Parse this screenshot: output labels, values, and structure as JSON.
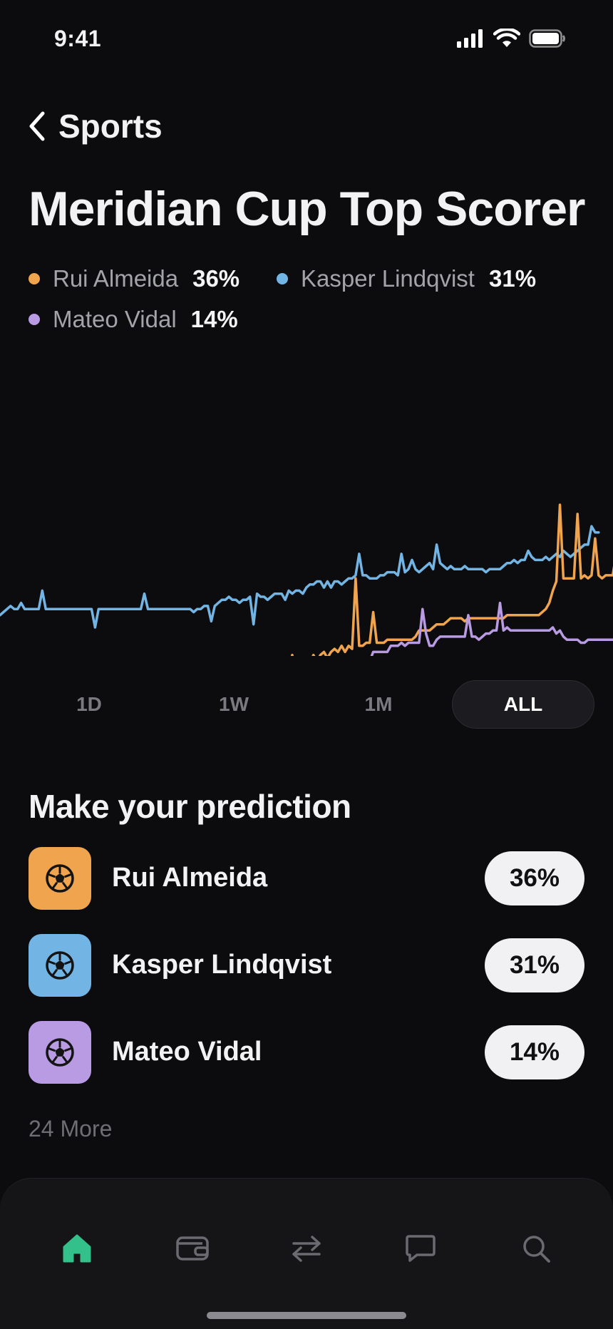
{
  "status_bar": {
    "time": "9:41"
  },
  "nav": {
    "back_label": "Sports"
  },
  "market": {
    "title": "Meridian Cup Top Scorer"
  },
  "legend": [
    {
      "name": "Rui Almeida",
      "pct": "36%",
      "color": "#f0a44e"
    },
    {
      "name": "Kasper Lindqvist",
      "pct": "31%",
      "color": "#72b5e4"
    },
    {
      "name": "Mateo Vidal",
      "pct": "14%",
      "color": "#b89be3"
    }
  ],
  "chart_data": {
    "type": "line",
    "title": "",
    "xlabel": "",
    "ylabel": "",
    "grid": false,
    "ylim": [
      0,
      60
    ],
    "series": [
      {
        "name": "Kasper Lindqvist",
        "color": "#72b5e4",
        "values": [
          4,
          5,
          6,
          7,
          6,
          6,
          8,
          6,
          6,
          6,
          6,
          6,
          12,
          6,
          6,
          6,
          6,
          6,
          6,
          6,
          6,
          6,
          6,
          6,
          6,
          6,
          6,
          0,
          6,
          6,
          6,
          6,
          6,
          6,
          6,
          6,
          6,
          6,
          6,
          6,
          6,
          11,
          6,
          6,
          6,
          6,
          6,
          6,
          6,
          6,
          6,
          6,
          6,
          6,
          6,
          5,
          6,
          6,
          7,
          7,
          2,
          7,
          8,
          9,
          9,
          10,
          9,
          9,
          8,
          9,
          9,
          10,
          1,
          11,
          10,
          10,
          9,
          10,
          11,
          11,
          11,
          9,
          12,
          11,
          12,
          12,
          11,
          13,
          14,
          14,
          15,
          15,
          13,
          15,
          13,
          15,
          15,
          14,
          15,
          16,
          16,
          17,
          24,
          17,
          17,
          16,
          16,
          16,
          17,
          17,
          18,
          18,
          18,
          17,
          24,
          18,
          19,
          22,
          19,
          18,
          19,
          20,
          21,
          19,
          27,
          21,
          20,
          19,
          20,
          19,
          19,
          19,
          20,
          19,
          19,
          19,
          19,
          19,
          18,
          19,
          19,
          19,
          19,
          20,
          21,
          21,
          22,
          21,
          22,
          22,
          25,
          23,
          22,
          22,
          22,
          23,
          22,
          23,
          24,
          23,
          25,
          24,
          23,
          24,
          25,
          26,
          27,
          27,
          33,
          31,
          31
        ],
        "start_index": 0
      },
      {
        "name": "Rui Almeida",
        "color": "#f0a44e",
        "values": [
          -13,
          -9,
          -16,
          -11,
          -19,
          -10,
          -12,
          -9,
          -11,
          -9,
          -8,
          -10,
          -8,
          -7,
          -8,
          -6,
          -8,
          -6,
          -7,
          16,
          -6,
          -6,
          -5,
          -5,
          5,
          -5,
          -5,
          -5,
          -4,
          -4,
          -4,
          -4,
          -4,
          -4,
          -4,
          -4,
          -3,
          -1,
          -1,
          -1,
          -1,
          0,
          1,
          1,
          1,
          2,
          3,
          3,
          3,
          3,
          2,
          3,
          3,
          3,
          3,
          3,
          3,
          3,
          3,
          3,
          3,
          3,
          4,
          4,
          4,
          4,
          4,
          4,
          4,
          4,
          4,
          4,
          5,
          6,
          8,
          12,
          15,
          40,
          16,
          16,
          16,
          16,
          37,
          16,
          17,
          16,
          17,
          29,
          17,
          16,
          17,
          17,
          17,
          24,
          37,
          24,
          24,
          24,
          25,
          25,
          25,
          25,
          25,
          26,
          41,
          -5,
          26,
          38,
          26,
          26,
          26,
          26,
          26,
          28,
          28,
          29,
          29,
          29,
          29,
          29,
          29,
          29,
          29,
          30,
          30,
          31,
          31,
          32,
          32,
          30,
          34,
          31,
          29,
          28
        ],
        "start_index": 82
      },
      {
        "name": "Mateo Vidal",
        "color": "#b89be3",
        "values": [
          -12,
          -12,
          -12,
          -12,
          -12,
          -12,
          -12,
          -12,
          -12,
          -14,
          -12,
          -12,
          -12,
          -11,
          -8,
          -8,
          -8,
          -8,
          -8,
          -6,
          -6,
          -6,
          -5,
          -6,
          -5,
          -5,
          -5,
          -5,
          6,
          -2,
          -6,
          -6,
          -4,
          -3,
          -3,
          -3,
          -3,
          -3,
          -3,
          -3,
          -3,
          4,
          -3,
          -3,
          -4,
          -3,
          -2,
          -2,
          -1,
          -1,
          8,
          -1,
          0,
          -1,
          -1,
          -1,
          -1,
          -1,
          -1,
          -1,
          -1,
          -1,
          -1,
          -1,
          -1,
          0,
          -2,
          -1,
          -3,
          -4,
          -4,
          -4,
          -4,
          -5,
          -5,
          -4,
          -4,
          -4,
          -4,
          -4,
          -4,
          -4,
          -4,
          -4,
          -4,
          -4,
          -4,
          -4,
          -3,
          -3,
          -1,
          0,
          1,
          1,
          1,
          2,
          2,
          3,
          4,
          5,
          6,
          6,
          7,
          7,
          7,
          7,
          8,
          -14,
          8,
          8,
          10,
          9,
          9,
          9,
          10,
          10,
          10,
          10,
          10
        ],
        "start_index": 92
      }
    ]
  },
  "ranges": {
    "options": [
      "1D",
      "1W",
      "1M",
      "ALL"
    ],
    "selected": "ALL"
  },
  "predictions": {
    "heading": "Make your prediction",
    "items": [
      {
        "name": "Rui Almeida",
        "pct": "36%",
        "color": "#f0a44e",
        "icon": "soccer-ball-icon"
      },
      {
        "name": "Kasper Lindqvist",
        "pct": "31%",
        "color": "#72b5e4",
        "icon": "soccer-ball-icon"
      },
      {
        "name": "Mateo Vidal",
        "pct": "14%",
        "color": "#b89be3",
        "icon": "soccer-ball-icon"
      }
    ],
    "more_label": "24 More"
  },
  "tab_bar": {
    "accent": "#34c08a",
    "inactive": "#6a6a70",
    "tabs": [
      {
        "icon": "home-icon",
        "active": true
      },
      {
        "icon": "wallet-icon",
        "active": false
      },
      {
        "icon": "swap-arrows-icon",
        "active": false
      },
      {
        "icon": "chat-bubble-icon",
        "active": false
      },
      {
        "icon": "search-icon",
        "active": false
      }
    ]
  }
}
